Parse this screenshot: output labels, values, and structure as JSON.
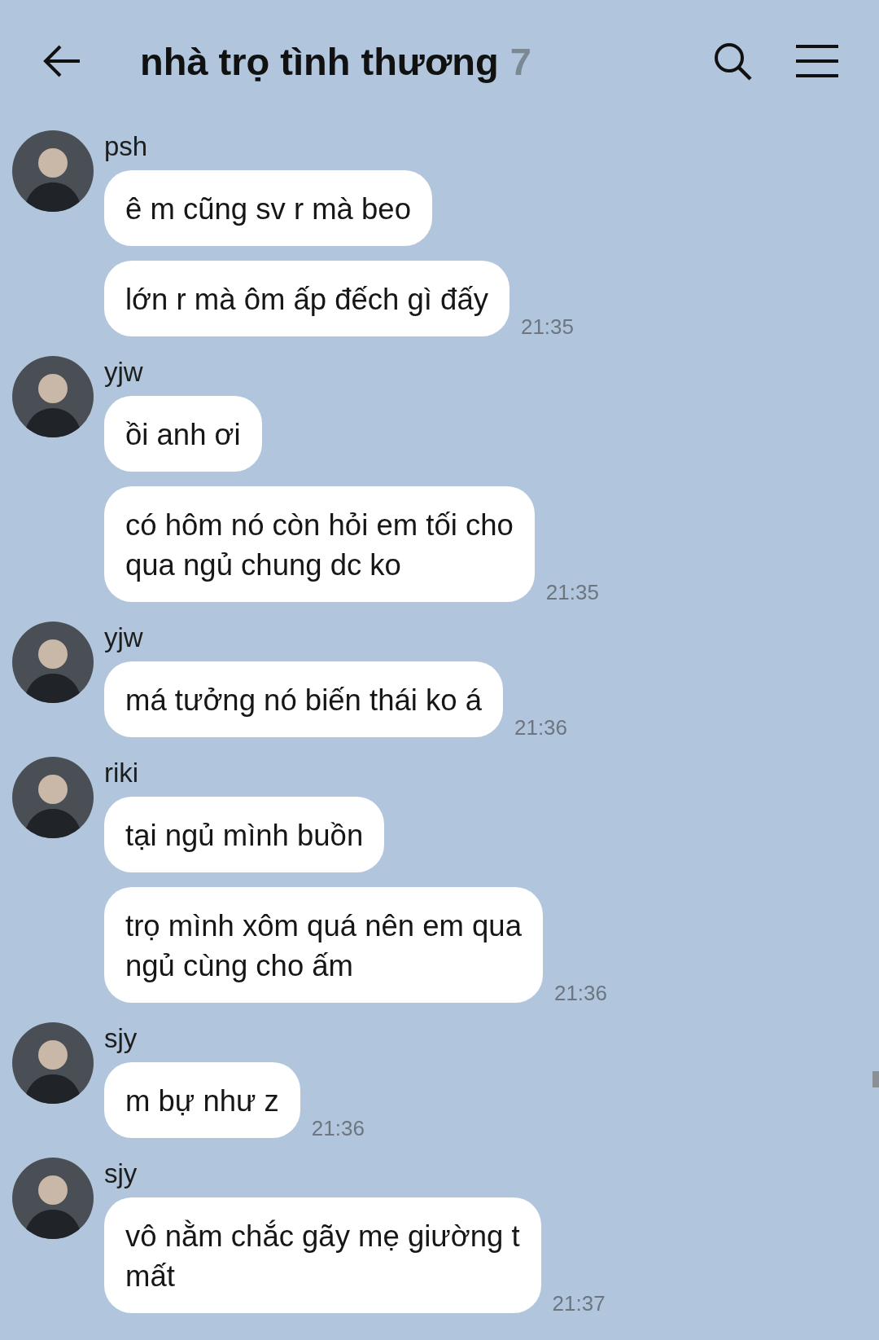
{
  "header": {
    "title": "nhà trọ tình thương",
    "member_count": "7"
  },
  "groups": [
    {
      "sender": "psh",
      "bubbles": [
        {
          "lines": [
            "ê m cũng sv r mà beo"
          ]
        },
        {
          "lines": [
            "lớn r mà ôm ấp đếch gì đấy"
          ],
          "time": "21:35"
        }
      ]
    },
    {
      "sender": "yjw",
      "bubbles": [
        {
          "lines": [
            "ồi anh ơi"
          ]
        },
        {
          "lines": [
            "có hôm nó còn hỏi em tối cho",
            "qua ngủ chung dc ko"
          ],
          "time": "21:35"
        }
      ]
    },
    {
      "sender": "yjw",
      "bubbles": [
        {
          "lines": [
            "má tưởng nó biến thái ko á"
          ],
          "time": "21:36"
        }
      ]
    },
    {
      "sender": "riki",
      "bubbles": [
        {
          "lines": [
            "tại ngủ mình buồn"
          ]
        },
        {
          "lines": [
            "trọ mình xôm quá nên em qua",
            "ngủ cùng cho ấm"
          ],
          "time": "21:36"
        }
      ]
    },
    {
      "sender": "sjy",
      "bubbles": [
        {
          "lines": [
            "m bự như z"
          ],
          "time": "21:36"
        }
      ]
    },
    {
      "sender": "sjy",
      "bubbles": [
        {
          "lines": [
            "vô nằm chắc gãy mẹ giường t",
            "mất"
          ],
          "time": "21:37"
        }
      ]
    }
  ]
}
